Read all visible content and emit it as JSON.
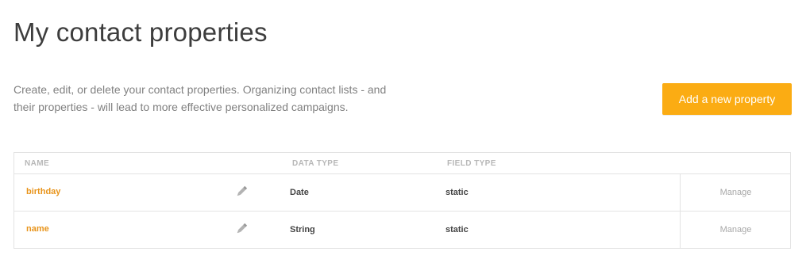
{
  "page": {
    "title": "My contact properties",
    "description_line1": "Create, edit, or delete your contact properties. Organizing contact lists - and",
    "description_line2": "their properties - will lead to more effective personalized campaigns."
  },
  "actions": {
    "add_label": "Add a new property"
  },
  "table": {
    "headers": {
      "name": "NAME",
      "data_type": "DATA TYPE",
      "field_type": "FIELD TYPE"
    },
    "rows": [
      {
        "name": "birthday",
        "data_type": "Date",
        "field_type": "static",
        "manage": "Manage"
      },
      {
        "name": "name",
        "data_type": "String",
        "field_type": "static",
        "manage": "Manage"
      }
    ]
  },
  "colors": {
    "accent": "#fbac13",
    "link": "#e8941b",
    "title": "#3d3d3d",
    "muted": "#808080",
    "border": "#e3e3e3"
  },
  "icons": {
    "edit": "pencil-icon"
  }
}
